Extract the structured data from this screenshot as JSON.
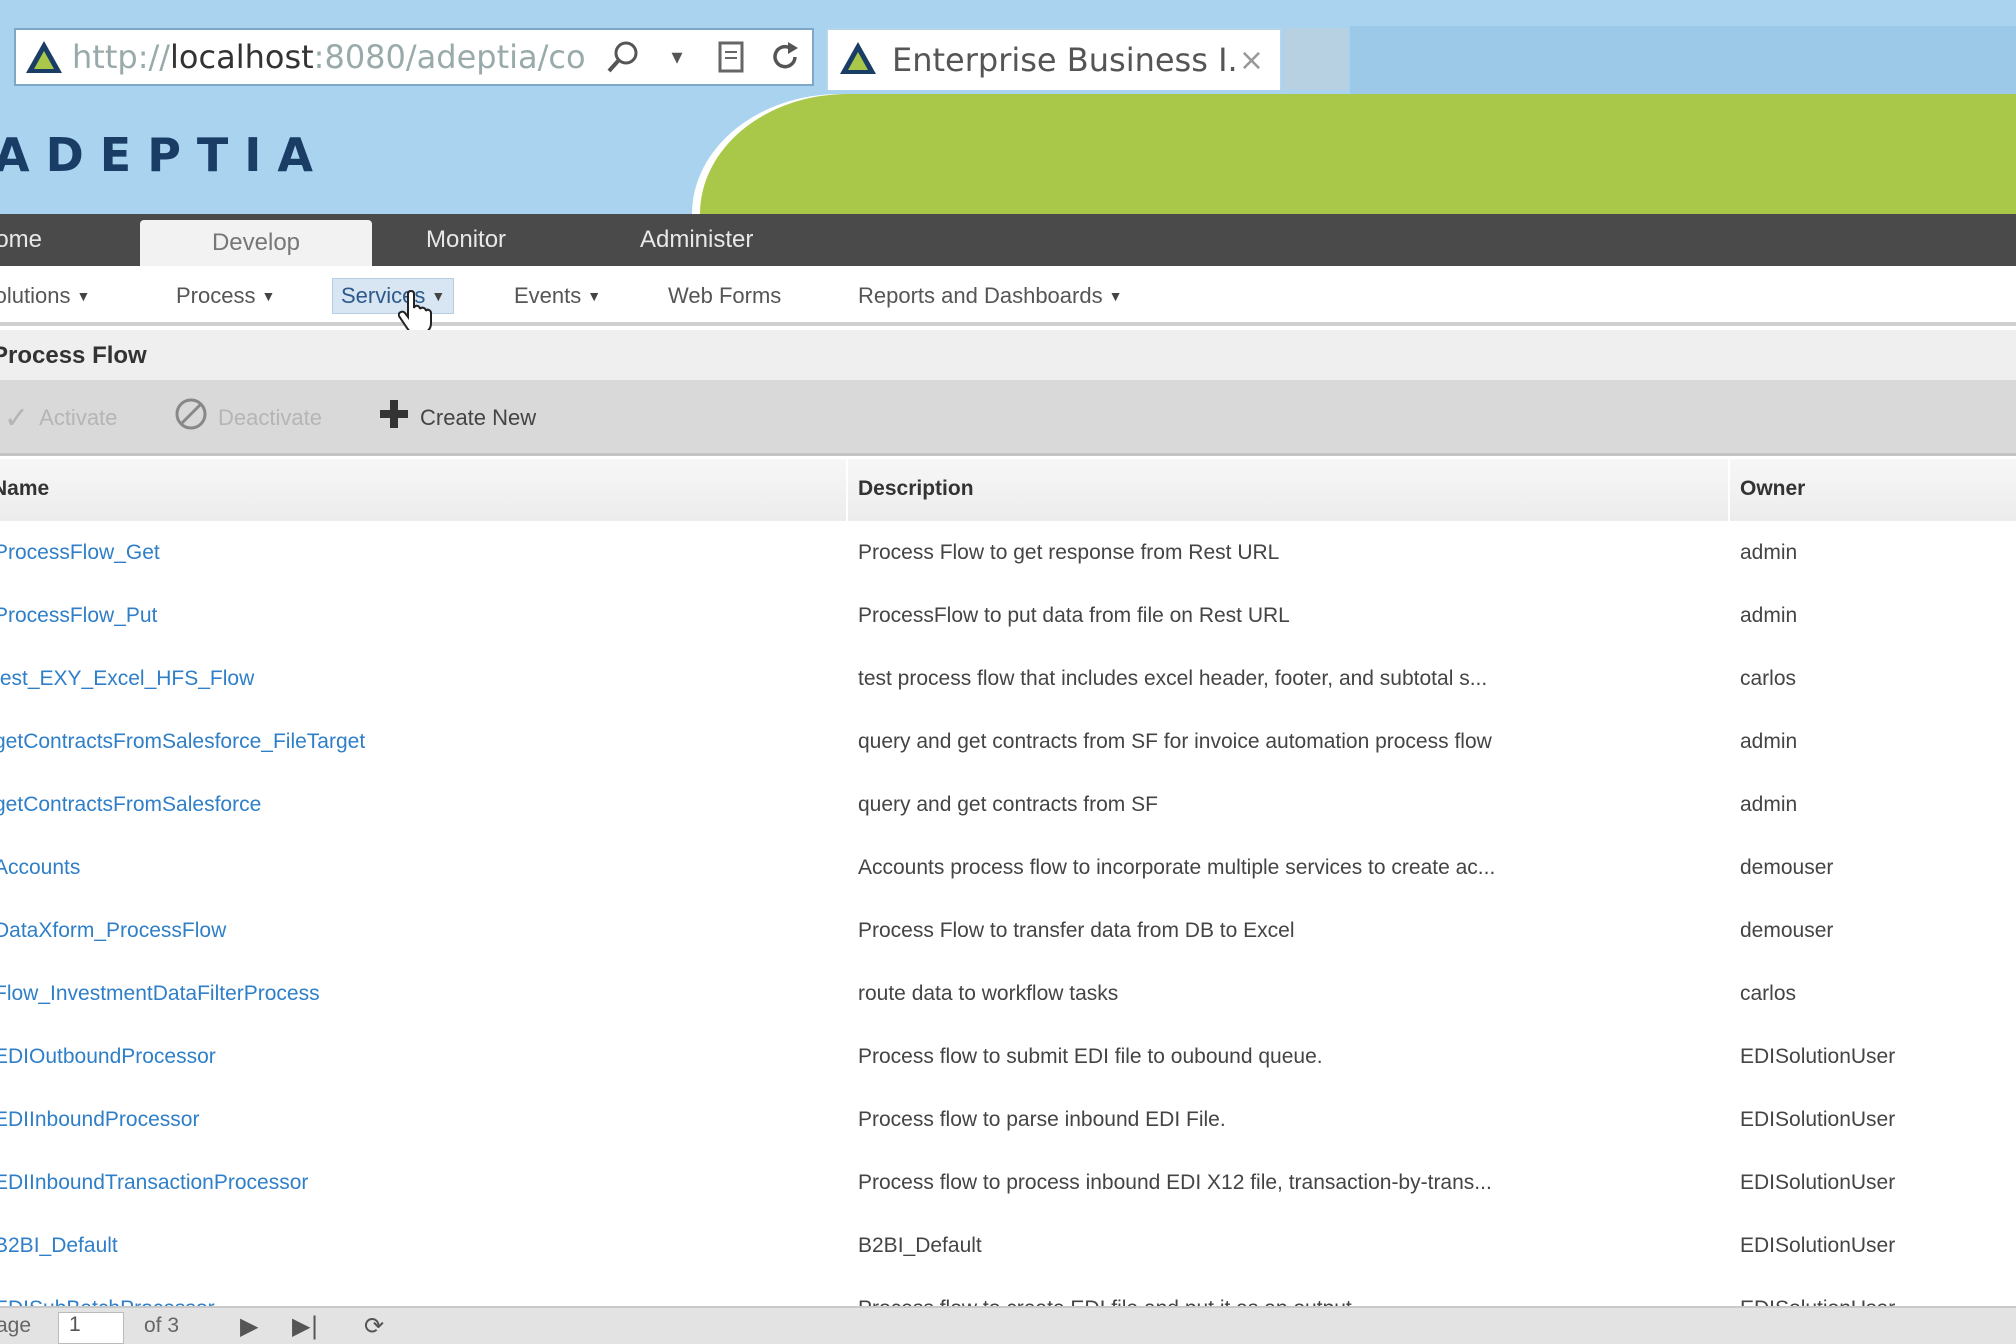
{
  "browser": {
    "url_prefix": "http://",
    "url_host": "localhost",
    "url_rest": ":8080/adeptia/co",
    "tab_title": "Enterprise Business I...",
    "tab_close": "×"
  },
  "brand": {
    "name": "ADEPTIA"
  },
  "colors": {
    "accent_green": "#a9c84a",
    "sky": "#a9d3ef",
    "nav_dark": "#4a4a4a",
    "link": "#2f7fc8"
  },
  "mainnav": {
    "items": [
      {
        "label": "Home"
      },
      {
        "label": "Develop"
      },
      {
        "label": "Monitor"
      },
      {
        "label": "Administer"
      }
    ]
  },
  "subnav": {
    "items": [
      {
        "label": "Solutions"
      },
      {
        "label": "Process"
      },
      {
        "label": "Services"
      },
      {
        "label": "Events"
      },
      {
        "label": "Web Forms"
      },
      {
        "label": "Reports and Dashboards"
      }
    ]
  },
  "section": {
    "title": "Process Flow"
  },
  "toolbar": {
    "activate": "Activate",
    "deactivate": "Deactivate",
    "create_new": "Create New"
  },
  "table": {
    "headers": {
      "name": "Name",
      "description": "Description",
      "owner": "Owner"
    },
    "rows": [
      {
        "name": "ProcessFlow_Get",
        "description": "Process Flow to get response from Rest URL",
        "owner": "admin"
      },
      {
        "name": "ProcessFlow_Put",
        "description": "ProcessFlow to put data from file on Rest URL",
        "owner": "admin"
      },
      {
        "name": "test_EXY_Excel_HFS_Flow",
        "description": "test process flow that includes excel header, footer, and subtotal s...",
        "owner": "carlos"
      },
      {
        "name": "getContractsFromSalesforce_FileTarget",
        "description": "query and get contracts from SF for invoice automation process flow",
        "owner": "admin"
      },
      {
        "name": "getContractsFromSalesforce",
        "description": "query and get contracts from SF",
        "owner": "admin"
      },
      {
        "name": "Accounts",
        "description": "Accounts process flow to incorporate multiple services to create ac...",
        "owner": "demouser"
      },
      {
        "name": "DataXform_ProcessFlow",
        "description": "Process Flow to transfer data from DB to Excel",
        "owner": "demouser"
      },
      {
        "name": "Flow_InvestmentDataFilterProcess",
        "description": "route data to workflow tasks",
        "owner": "carlos"
      },
      {
        "name": "EDIOutboundProcessor",
        "description": "Process flow to submit EDI file to oubound queue.",
        "owner": "EDISolutionUser"
      },
      {
        "name": "EDIInboundProcessor",
        "description": "Process flow to parse inbound EDI File.",
        "owner": "EDISolutionUser"
      },
      {
        "name": "EDIInboundTransactionProcessor",
        "description": "Process flow to process inbound EDI X12 file, transaction-by-trans...",
        "owner": "EDISolutionUser"
      },
      {
        "name": "B2BI_Default",
        "description": "B2BI_Default",
        "owner": "EDISolutionUser"
      },
      {
        "name": "EDISubBatchProcessor",
        "description": "Process flow to create EDI file and put it as an output",
        "owner": "EDISolutionUser"
      }
    ]
  },
  "pager": {
    "page_label": "Page",
    "page_value": "1",
    "of_label": "of 3"
  }
}
